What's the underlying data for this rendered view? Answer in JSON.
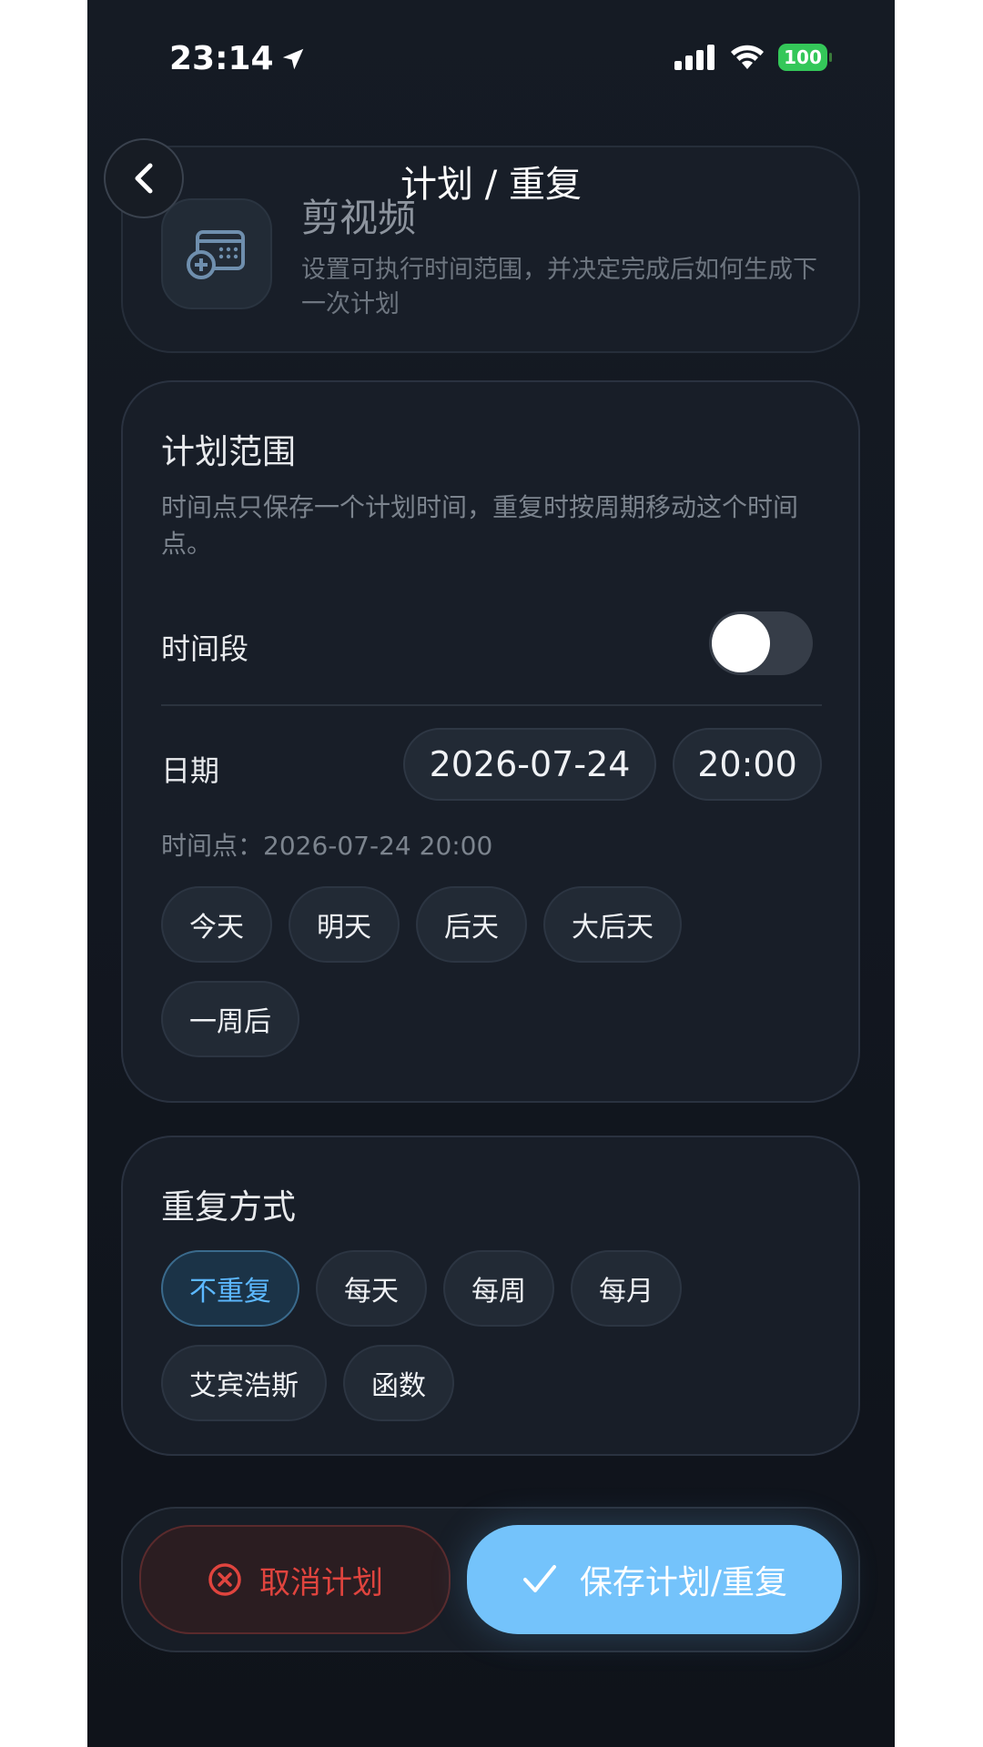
{
  "status_bar": {
    "time": "23:14",
    "battery": "100",
    "icons": [
      "location-arrow-icon",
      "signal-icon",
      "wifi-icon",
      "battery-icon"
    ]
  },
  "nav": {
    "title": "计划 / 重复",
    "back_icon": "chevron-left-icon"
  },
  "header": {
    "title": "剪视频",
    "description": "设置可执行时间范围，并决定完成后如何生成下一次计划",
    "icon": "calendar-add-icon"
  },
  "plan_range": {
    "title": "计划范围",
    "description": "时间点只保存一个计划时间，重复时按周期移动这个时间点。",
    "toggle_label": "时间段",
    "toggle_on": false,
    "date_label": "日期",
    "date_value": "2026-07-24",
    "time_value": "20:00",
    "timepoint": "时间点：2026-07-24 20:00",
    "quick_picks": [
      "今天",
      "明天",
      "后天",
      "大后天",
      "一周后"
    ]
  },
  "repeat": {
    "title": "重复方式",
    "options": [
      "不重复",
      "每天",
      "每周",
      "每月",
      "艾宾浩斯",
      "函数"
    ],
    "selected": "不重复"
  },
  "actions": {
    "cancel_label": "取消计划",
    "save_label": "保存计划/重复"
  },
  "colors": {
    "accent": "#74c3fb",
    "selected_text": "#5cb8ff",
    "danger": "#e0443e",
    "battery": "#34c759"
  }
}
